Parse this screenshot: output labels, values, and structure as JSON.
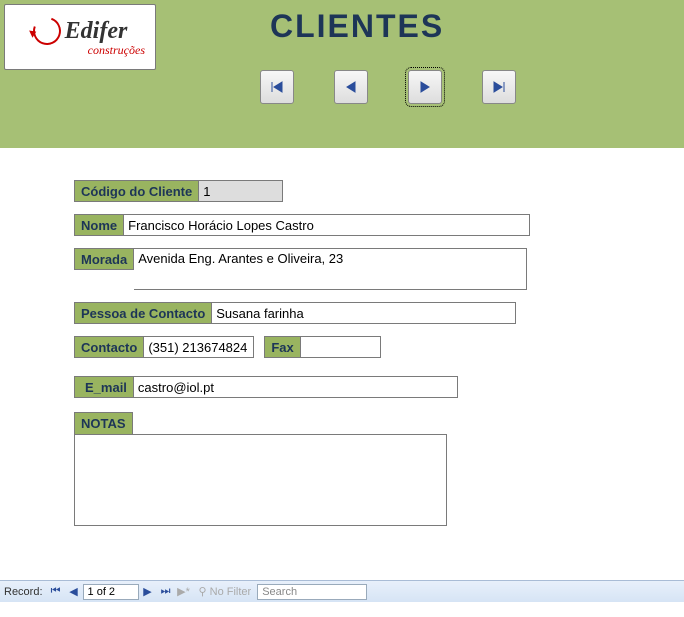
{
  "header": {
    "title": "CLIENTES",
    "logo_main": "Edifer",
    "logo_sub": "construções"
  },
  "form": {
    "codigo_label": "Código do Cliente",
    "codigo_value": "1",
    "nome_label": "Nome",
    "nome_value": "Francisco Horácio Lopes Castro",
    "morada_label": "Morada",
    "morada_value": "Avenida Eng. Arantes e Oliveira, 23",
    "pessoa_label": "Pessoa de Contacto",
    "pessoa_value": "Susana farinha",
    "contacto_label": "Contacto",
    "contacto_value": "(351) 213674824",
    "fax_label": "Fax",
    "fax_value": "",
    "email_label": "E_mail",
    "email_value": "castro@iol.pt",
    "notas_label": "NOTAS",
    "notas_value": ""
  },
  "status": {
    "record_label": "Record:",
    "record_value": "1 of 2",
    "no_filter": "No Filter",
    "search_placeholder": "Search"
  }
}
